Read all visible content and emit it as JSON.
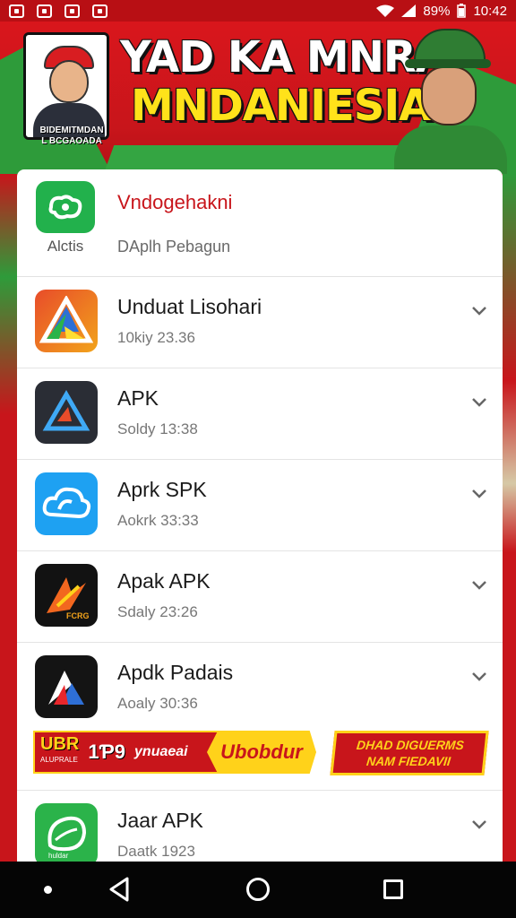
{
  "status_bar": {
    "battery": "89%",
    "time": "10:42"
  },
  "banner": {
    "title_line1": "YAD KA MNRAI",
    "title_line2": "MNDANIESIA",
    "badge_text_line1": "BIDEMITMDAN",
    "badge_text_line2": "L BCGAOADA"
  },
  "header": {
    "app_caption": "Alctis",
    "title": "Vndogehakni",
    "subtitle": "DAplh Pebagun"
  },
  "apps": [
    {
      "title": "Unduat Lisohari",
      "subtitle": "10kiy 23.36",
      "icon": "prism-icon"
    },
    {
      "title": "APK",
      "subtitle": "Soldy 13:38",
      "icon": "delta-icon"
    },
    {
      "title": "Aprk SPK",
      "subtitle": "Aokrk 33:33",
      "icon": "cloud-icon"
    },
    {
      "title": "Apak APK",
      "subtitle": "Sdaly 23:26",
      "icon": "arrow-icon"
    },
    {
      "title": "Apdk Padais",
      "subtitle": "Aoaly 30:36",
      "icon": "triangle-icon"
    },
    {
      "title": "Jaar APK",
      "subtitle": "Daatk 1923",
      "icon": "leaf-icon"
    }
  ],
  "ad": {
    "brand": "UBR",
    "middle_code": "1Ƥ9",
    "middle_text": "ynuaeai",
    "highlight": "Ubobdur",
    "right_line1": "DHAD DIGUERMS",
    "right_line2": "NAM FIEDAVII",
    "brand_sub": "ALUPRALE"
  },
  "colors": {
    "brand_red": "#c8151b",
    "accent_yellow": "#ffd21a",
    "brand_green": "#2e9b3a"
  }
}
